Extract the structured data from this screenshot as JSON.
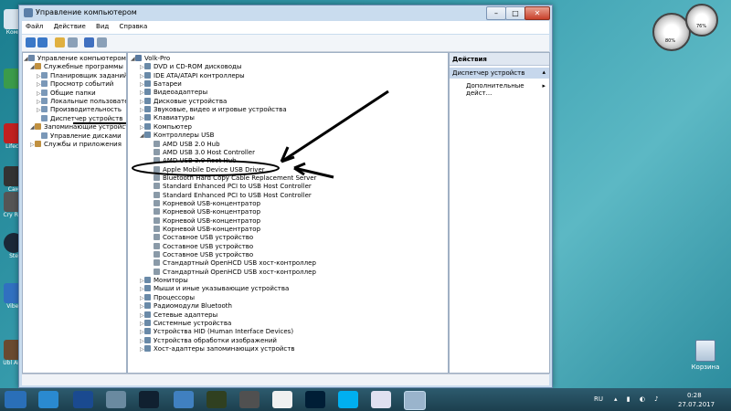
{
  "window": {
    "title": "Управление компьютером",
    "min_glyph": "–",
    "max_glyph": "□",
    "close_glyph": "✕"
  },
  "menu": [
    "Файл",
    "Действие",
    "Вид",
    "Справка"
  ],
  "left_tree": [
    {
      "label": "Управление компьютером (ло",
      "level": 0,
      "arrow": "◢"
    },
    {
      "label": "Служебные программы",
      "level": 1,
      "arrow": "◢"
    },
    {
      "label": "Планировщик заданий",
      "level": 2,
      "arrow": "▷"
    },
    {
      "label": "Просмотр событий",
      "level": 2,
      "arrow": "▷"
    },
    {
      "label": "Общие папки",
      "level": 2,
      "arrow": "▷"
    },
    {
      "label": "Локальные пользовате",
      "level": 2,
      "arrow": "▷"
    },
    {
      "label": "Производительность",
      "level": 2,
      "arrow": "▷"
    },
    {
      "label": "Диспетчер устройств",
      "level": 2,
      "arrow": ""
    },
    {
      "label": "Запоминающие устройст",
      "level": 1,
      "arrow": "◢"
    },
    {
      "label": "Управление дисками",
      "level": 2,
      "arrow": ""
    },
    {
      "label": "Службы и приложения",
      "level": 1,
      "arrow": "▷"
    }
  ],
  "device_tree": [
    {
      "label": "Volk-Pro",
      "level": 0,
      "arrow": "◢"
    },
    {
      "label": "DVD и CD-ROM дисководы",
      "level": 1,
      "arrow": "▷"
    },
    {
      "label": "IDE ATA/ATAPI контроллеры",
      "level": 1,
      "arrow": "▷"
    },
    {
      "label": "Батареи",
      "level": 1,
      "arrow": "▷"
    },
    {
      "label": "Видеоадаптеры",
      "level": 1,
      "arrow": "▷"
    },
    {
      "label": "Дисковые устройства",
      "level": 1,
      "arrow": "▷"
    },
    {
      "label": "Звуковые, видео и игровые устройства",
      "level": 1,
      "arrow": "▷"
    },
    {
      "label": "Клавиатуры",
      "level": 1,
      "arrow": "▷"
    },
    {
      "label": "Компьютер",
      "level": 1,
      "arrow": "▷"
    },
    {
      "label": "Контроллеры USB",
      "level": 1,
      "arrow": "◢"
    },
    {
      "label": "AMD USB 2.0 Hub",
      "level": 2,
      "arrow": ""
    },
    {
      "label": "AMD USB 3.0 Host Controller",
      "level": 2,
      "arrow": ""
    },
    {
      "label": "AMD USB 3.0 Root Hub",
      "level": 2,
      "arrow": ""
    },
    {
      "label": "Apple Mobile Device USB Driver",
      "level": 2,
      "arrow": ""
    },
    {
      "label": "Bluetooth Hard Copy Cable Replacement Server",
      "level": 2,
      "arrow": ""
    },
    {
      "label": "Standard Enhanced PCI to USB Host Controller",
      "level": 2,
      "arrow": ""
    },
    {
      "label": "Standard Enhanced PCI to USB Host Controller",
      "level": 2,
      "arrow": ""
    },
    {
      "label": "Корневой USB-концентратор",
      "level": 2,
      "arrow": ""
    },
    {
      "label": "Корневой USB-концентратор",
      "level": 2,
      "arrow": ""
    },
    {
      "label": "Корневой USB-концентратор",
      "level": 2,
      "arrow": ""
    },
    {
      "label": "Корневой USB-концентратор",
      "level": 2,
      "arrow": ""
    },
    {
      "label": "Составное USB устройство",
      "level": 2,
      "arrow": ""
    },
    {
      "label": "Составное USB устройство",
      "level": 2,
      "arrow": ""
    },
    {
      "label": "Составное USB устройство",
      "level": 2,
      "arrow": ""
    },
    {
      "label": "Стандартный OpenHCD USB хост-контроллер",
      "level": 2,
      "arrow": ""
    },
    {
      "label": "Стандартный OpenHCD USB хост-контроллер",
      "level": 2,
      "arrow": ""
    },
    {
      "label": "Мониторы",
      "level": 1,
      "arrow": "▷"
    },
    {
      "label": "Мыши и иные указывающие устройства",
      "level": 1,
      "arrow": "▷"
    },
    {
      "label": "Процессоры",
      "level": 1,
      "arrow": "▷"
    },
    {
      "label": "Радиомодули Bluetooth",
      "level": 1,
      "arrow": "▷"
    },
    {
      "label": "Сетевые адаптеры",
      "level": 1,
      "arrow": "▷"
    },
    {
      "label": "Системные устройства",
      "level": 1,
      "arrow": "▷"
    },
    {
      "label": "Устройства HID (Human Interface Devices)",
      "level": 1,
      "arrow": "▷"
    },
    {
      "label": "Устройства обработки изображений",
      "level": 1,
      "arrow": "▷"
    },
    {
      "label": "Хост-адаптеры запоминающих устройств",
      "level": 1,
      "arrow": "▷"
    }
  ],
  "actions": {
    "header": "Действия",
    "selected": "Диспетчер устройств",
    "item": "Дополнительные дейст...",
    "item_arrow": "▸",
    "sel_arrow": "▴"
  },
  "desktop": {
    "left_icons": [
      "Комп",
      "",
      "Lifeca",
      "Сам",
      "Cry\nRoc",
      "Ste",
      "Viber",
      "Ubl\nAnd"
    ],
    "recycle_bin": "Корзина",
    "gauge_1": "80%",
    "gauge_2": "76%"
  },
  "tray": {
    "lang": "RU",
    "time": "0:28",
    "date": "27.07.2017"
  },
  "colors": {
    "accent": "#1c3f4e",
    "annotation": "#000000"
  }
}
